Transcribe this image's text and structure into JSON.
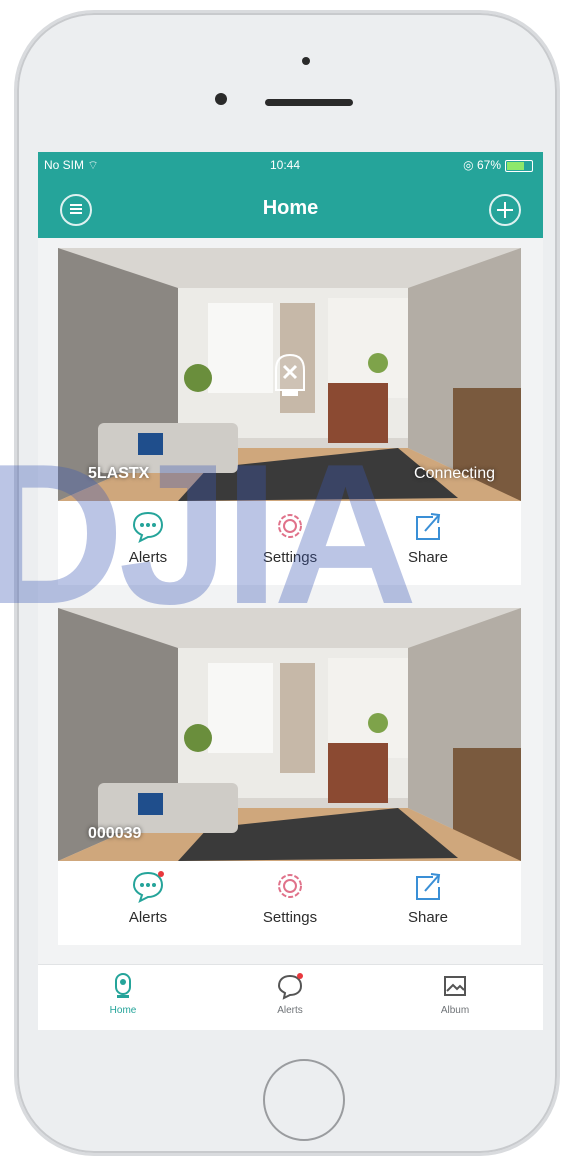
{
  "status_bar": {
    "carrier": "No SIM",
    "time": "10:44",
    "battery": "67%"
  },
  "header": {
    "title": "Home"
  },
  "cameras": [
    {
      "name": "5LASTX",
      "status": "Connecting",
      "actions": {
        "alerts": "Alerts",
        "settings": "Settings",
        "share": "Share"
      }
    },
    {
      "name": "000039",
      "status": "",
      "actions": {
        "alerts": "Alerts",
        "settings": "Settings",
        "share": "Share"
      }
    }
  ],
  "tabbar": {
    "home": "Home",
    "alerts": "Alerts",
    "album": "Album"
  },
  "colors": {
    "accent": "#25a49a",
    "settings": "#e0728a",
    "share": "#3a8fd6",
    "alert_dot": "#e8383d"
  },
  "watermark": "DJIA"
}
